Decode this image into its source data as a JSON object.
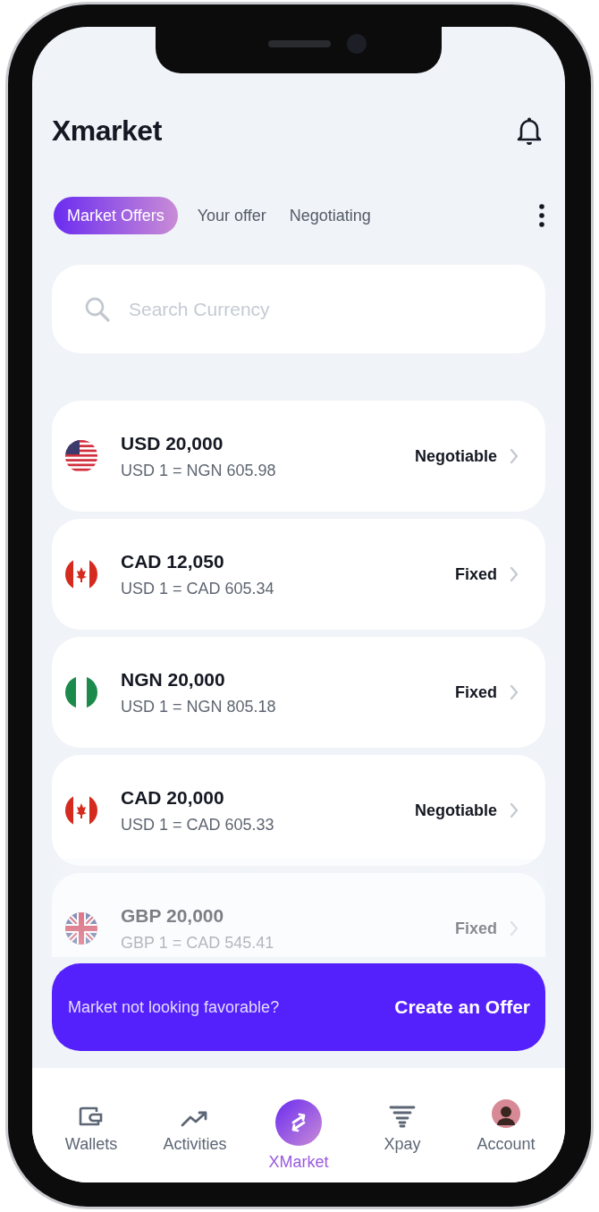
{
  "header": {
    "title": "Xmarket"
  },
  "tabs": [
    {
      "label": "Market Offers",
      "selected": true
    },
    {
      "label": "Your offer",
      "selected": false
    },
    {
      "label": "Negotiating",
      "selected": false
    }
  ],
  "search": {
    "placeholder": "Search Currency"
  },
  "offers": [
    {
      "amount": "USD 20,000",
      "rate": "USD 1 = NGN 605.98",
      "terms": "Negotiable"
    },
    {
      "amount": "CAD 12,050",
      "rate": "USD 1 = CAD 605.34",
      "terms": "Fixed"
    },
    {
      "amount": "NGN 20,000",
      "rate": "USD 1 = NGN 805.18",
      "terms": "Fixed"
    },
    {
      "amount": "CAD 20,000",
      "rate": "USD 1 = CAD 605.33",
      "terms": "Negotiable"
    },
    {
      "amount": "GBP 20,000",
      "rate": "GBP 1 = CAD 545.41",
      "terms": "Fixed"
    }
  ],
  "banner": {
    "message": "Market not looking favorable?",
    "action": "Create an Offer"
  },
  "nav": [
    {
      "label": "Wallets",
      "selected": false
    },
    {
      "label": "Activities",
      "selected": false
    },
    {
      "label": "XMarket",
      "selected": true
    },
    {
      "label": "Xpay",
      "selected": false
    },
    {
      "label": "Account",
      "selected": false
    }
  ]
}
